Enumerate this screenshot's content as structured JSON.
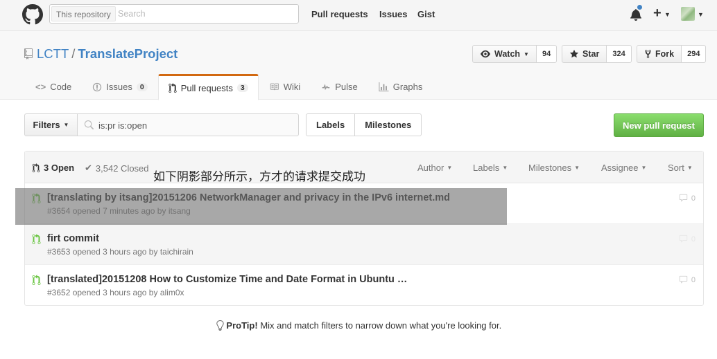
{
  "header": {
    "search_scope": "This repository",
    "search_placeholder": "Search",
    "nav": [
      "Pull requests",
      "Issues",
      "Gist"
    ],
    "plus_icon": "plus-icon",
    "notification_icon": "bell-icon"
  },
  "repo": {
    "owner": "LCTT",
    "separator": "/",
    "name": "TranslateProject",
    "watch": {
      "label": "Watch",
      "count": "94"
    },
    "star": {
      "label": "Star",
      "count": "324"
    },
    "fork": {
      "label": "Fork",
      "count": "294"
    }
  },
  "tabs": [
    {
      "label": "Code",
      "icon": "code-icon",
      "count": ""
    },
    {
      "label": "Issues",
      "icon": "issue-icon",
      "count": "0"
    },
    {
      "label": "Pull requests",
      "icon": "pull-request-icon",
      "count": "3",
      "selected": true
    },
    {
      "label": "Wiki",
      "icon": "book-icon",
      "count": ""
    },
    {
      "label": "Pulse",
      "icon": "pulse-icon",
      "count": ""
    },
    {
      "label": "Graphs",
      "icon": "graph-icon",
      "count": ""
    }
  ],
  "subnav": {
    "filters_label": "Filters",
    "filter_query": "is:pr is:open",
    "labels_label": "Labels",
    "milestones_label": "Milestones",
    "new_pr_label": "New pull request"
  },
  "list": {
    "open_label": "3 Open",
    "closed_label": "3,542 Closed",
    "filters": [
      "Author",
      "Labels",
      "Milestones",
      "Assignee",
      "Sort"
    ],
    "items": [
      {
        "title": "[translating by itsang]20151206 NetworkManager and privacy in the IPv6 internet.md",
        "meta_prefix": "#3654 opened 7 minutes ago by",
        "user": "itsang",
        "comments": "0"
      },
      {
        "title": "firt commit",
        "meta_prefix": "#3653 opened 3 hours ago by",
        "user": "taichirain",
        "comments": "0"
      },
      {
        "title": "[translated]20151208 How to Customize Time and Date Format in Ubuntu …",
        "meta_prefix": "#3652 opened 3 hours ago by",
        "user": "alim0x",
        "comments": "0"
      }
    ]
  },
  "annotation": "如下阴影部分所示，方才的请求提交成功",
  "protip": {
    "label": "ProTip!",
    "text": "Mix and match filters to narrow down what you're looking for."
  },
  "colors": {
    "accent": "#d26911",
    "link": "#4183c4",
    "green": "#6cc644",
    "button_green": "#60b044"
  }
}
